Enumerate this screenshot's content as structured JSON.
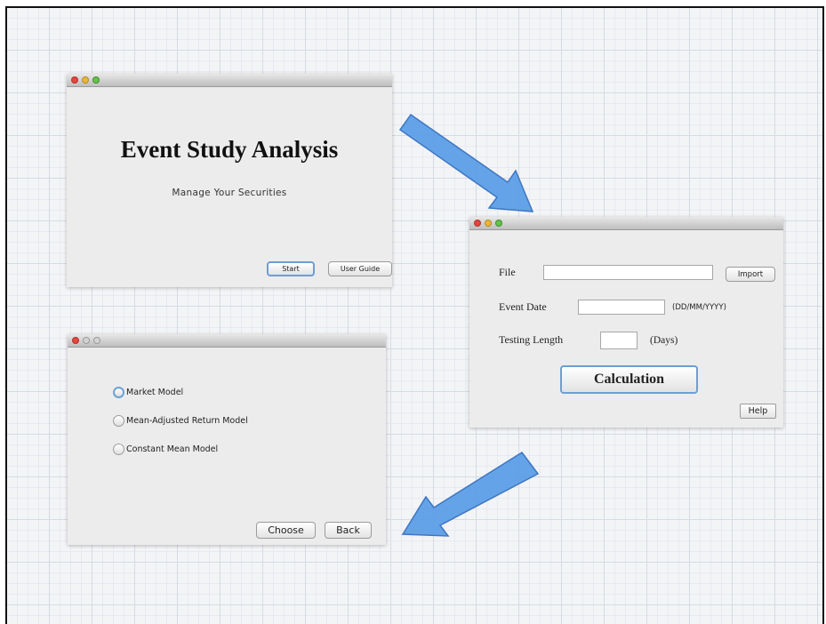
{
  "window1": {
    "title": "Event Study Analysis",
    "subtitle": "Manage Your Securities",
    "start_label": "Start",
    "user_guide_label": "User Guide"
  },
  "window2": {
    "file_label": "File",
    "import_label": "Import",
    "event_date_label": "Event Date",
    "date_format_hint": "(DD/MM/YYYY)",
    "testing_length_label": "Testing Length",
    "days_label": "(Days)",
    "calculation_label": "Calculation",
    "help_label": "Help"
  },
  "window3": {
    "options": [
      {
        "label": "Market Model",
        "selected": true
      },
      {
        "label": "Mean-Adjusted Return Model",
        "selected": false
      },
      {
        "label": "Constant Mean Model",
        "selected": false
      }
    ],
    "choose_label": "Choose",
    "back_label": "Back"
  },
  "colors": {
    "arrow_fill": "#5c9ee6",
    "arrow_border": "#3f76c2",
    "radio_selected_ring": "#6aa2d8"
  }
}
